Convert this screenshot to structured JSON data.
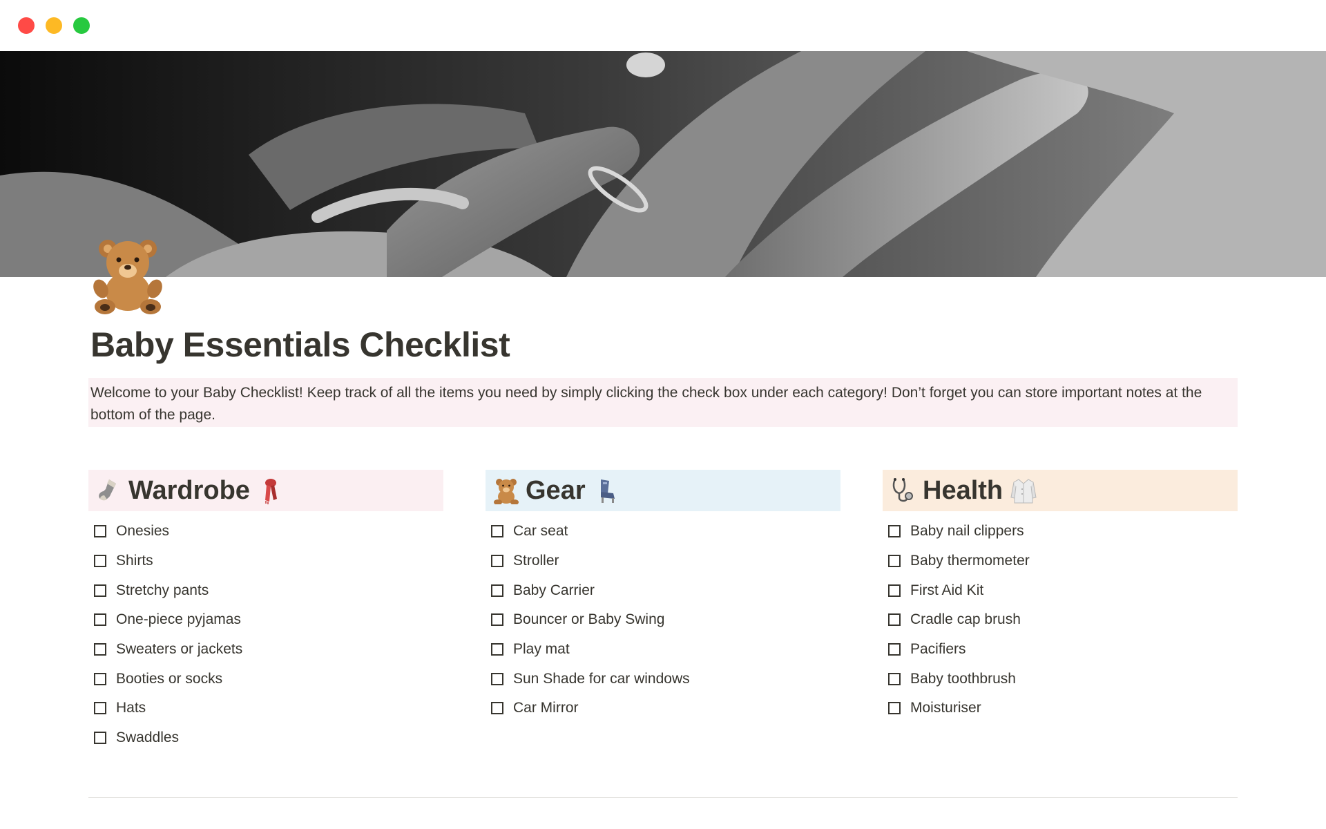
{
  "window": {
    "controls": [
      "close",
      "minimize",
      "zoom"
    ]
  },
  "page": {
    "icon": "teddy-bear-icon",
    "title": "Baby Essentials Checklist",
    "callout": "Welcome to your Baby Checklist! Keep track of all the items you need by simply clicking the check box under each category! Don’t forget you can store important notes at the bottom of the page."
  },
  "columns": [
    {
      "title": "Wardrobe",
      "icon_left": "sock-icon",
      "icon_right": "scarf-icon",
      "color": "#fbeff2",
      "items": [
        "Onesies",
        "Shirts",
        "Stretchy pants",
        "One-piece pyjamas",
        "Sweaters or jackets",
        "Booties or socks",
        "Hats",
        "Swaddles"
      ]
    },
    {
      "title": "Gear",
      "icon_left": "teddy-bear-icon",
      "icon_right": "seat-icon",
      "color": "#e6f2f8",
      "items": [
        "Car seat",
        "Stroller",
        "Baby Carrier",
        "Bouncer or Baby Swing",
        "Play mat",
        "Sun Shade for car windows",
        "Car Mirror"
      ]
    },
    {
      "title": "Health",
      "icon_left": "stethoscope-icon",
      "icon_right": "lab-coat-icon",
      "color": "#fbecdd",
      "items": [
        "Baby nail clippers",
        "Baby thermometer",
        "First Aid Kit",
        "Cradle cap brush",
        "Pacifiers",
        "Baby toothbrush",
        "Moisturiser"
      ]
    }
  ]
}
